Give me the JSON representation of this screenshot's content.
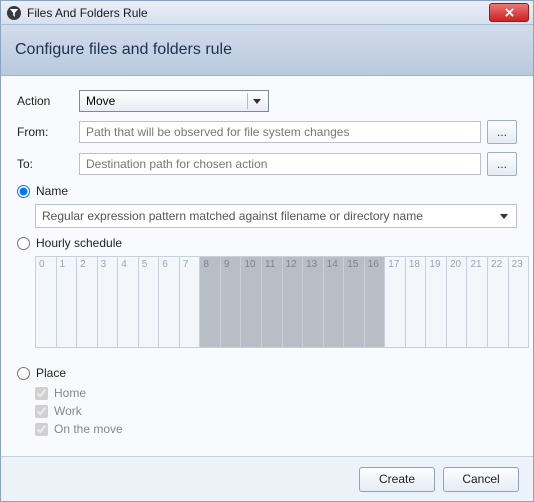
{
  "titlebar": {
    "title": "Files And Folders Rule"
  },
  "header": {
    "title": "Configure files and folders rule"
  },
  "form": {
    "action_label": "Action",
    "action_value": "Move",
    "from_label": "From:",
    "from_placeholder": "Path that will be observed for file system changes",
    "to_label": "To:",
    "to_placeholder": "Destination path for chosen action",
    "browse_label": "..."
  },
  "criteria": {
    "name_label": "Name",
    "name_pattern_placeholder": "Regular expression pattern matched against filename or directory name",
    "hourly_label": "Hourly schedule",
    "hours": [
      "0",
      "1",
      "2",
      "3",
      "4",
      "5",
      "6",
      "7",
      "8",
      "9",
      "10",
      "11",
      "12",
      "13",
      "14",
      "15",
      "16",
      "17",
      "18",
      "19",
      "20",
      "21",
      "22",
      "23"
    ],
    "hours_selected": [
      false,
      false,
      false,
      false,
      false,
      false,
      false,
      false,
      true,
      true,
      true,
      true,
      true,
      true,
      true,
      true,
      true,
      false,
      false,
      false,
      false,
      false,
      false,
      false
    ],
    "place_label": "Place",
    "places": {
      "home": "Home",
      "work": "Work",
      "move": "On the move"
    }
  },
  "footer": {
    "create": "Create",
    "cancel": "Cancel"
  }
}
